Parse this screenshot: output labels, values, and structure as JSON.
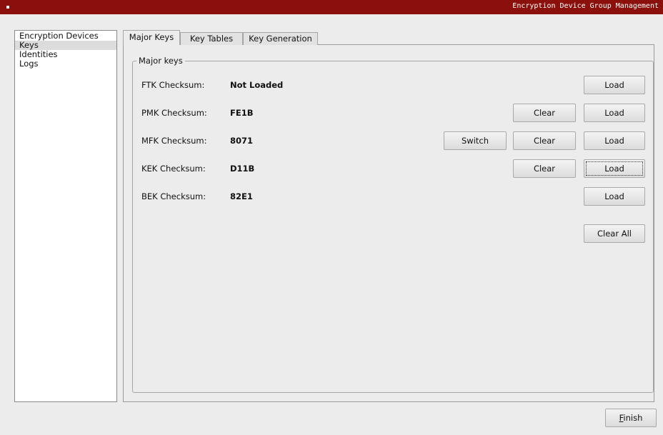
{
  "window": {
    "title": "Encryption Device Group Management"
  },
  "sidebar": {
    "items": [
      {
        "label": "Encryption Devices",
        "selected": false
      },
      {
        "label": "Keys",
        "selected": true
      },
      {
        "label": "Identities",
        "selected": false
      },
      {
        "label": "Logs",
        "selected": false
      }
    ]
  },
  "tabs": [
    {
      "label": "Major Keys",
      "active": true
    },
    {
      "label": "Key Tables",
      "active": false
    },
    {
      "label": "Key Generation",
      "active": false
    }
  ],
  "group": {
    "title": "Major keys"
  },
  "keys": [
    {
      "label": "FTK Checksum:",
      "value": "Not Loaded"
    },
    {
      "label": "PMK Checksum:",
      "value": "FE1B"
    },
    {
      "label": "MFK Checksum:",
      "value": "8071"
    },
    {
      "label": "KEK Checksum:",
      "value": "D11B"
    },
    {
      "label": "BEK Checksum:",
      "value": "82E1"
    }
  ],
  "buttons": {
    "load": "Load",
    "clear": "Clear",
    "switch": "Switch",
    "clear_all": "Clear All",
    "finish_mnemonic": "F",
    "finish_rest": "inish"
  }
}
